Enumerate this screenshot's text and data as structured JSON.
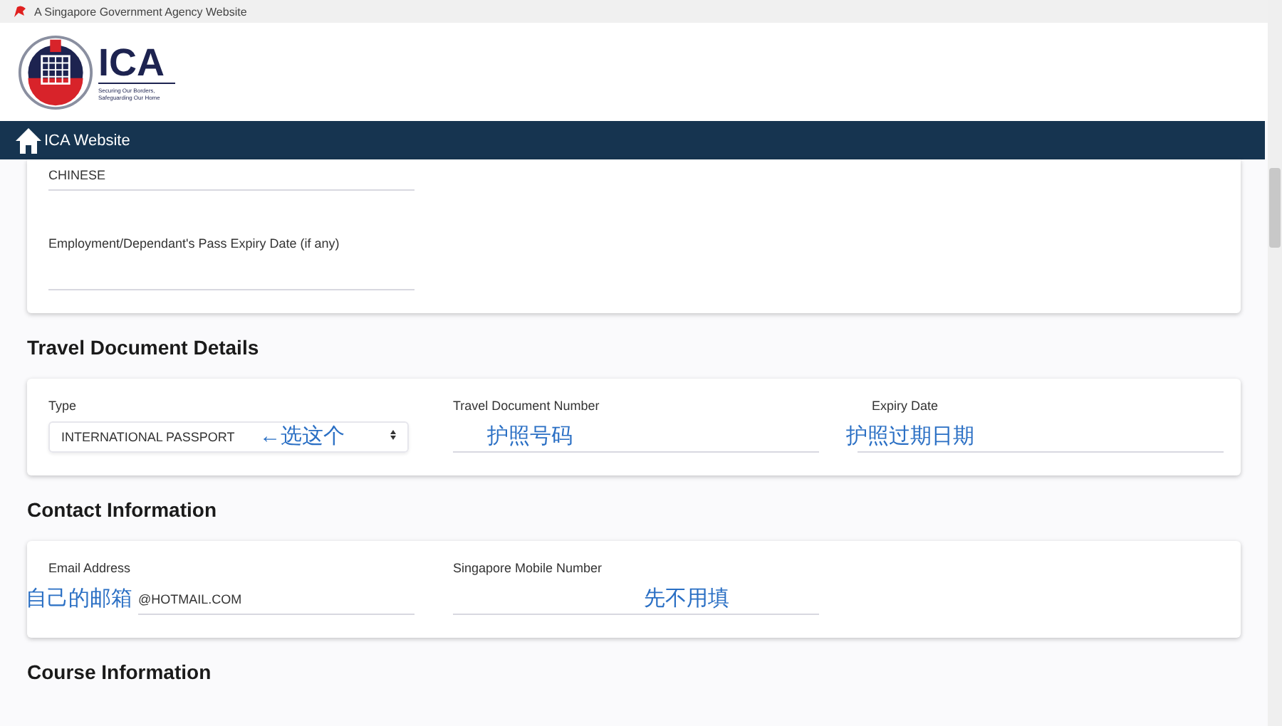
{
  "gov_bar": {
    "text": "A Singapore Government Agency Website"
  },
  "header": {
    "logo_text": "ICA",
    "tagline": "Securing Our Borders, Safeguarding Our Home"
  },
  "nav": {
    "label": "ICA Website"
  },
  "sections": [
    {
      "fields": [
        {
          "kind": "text",
          "value": "CHINESE"
        },
        {
          "kind": "text",
          "label": "Employment/Dependant's Pass Expiry Date (if any)"
        }
      ]
    },
    {
      "heading": "Travel Document Details",
      "fields": [
        {
          "kind": "select",
          "label": "Type",
          "value": "INTERNATIONAL PASSPORT",
          "annotation": "←选这个"
        },
        {
          "kind": "text",
          "label": "Travel Document Number",
          "annotation": "护照号码"
        },
        {
          "kind": "text",
          "label": "Expiry Date",
          "annotation": "护照过期日期"
        }
      ]
    },
    {
      "heading": "Contact Information",
      "fields": [
        {
          "kind": "text",
          "label": "Email Address",
          "value": "@HOTMAIL.COM",
          "annotation": "自己的邮箱"
        },
        {
          "kind": "text",
          "label": "Singapore Mobile Number",
          "annotation": "先不用填"
        }
      ]
    },
    {
      "heading": "Course Information"
    }
  ]
}
